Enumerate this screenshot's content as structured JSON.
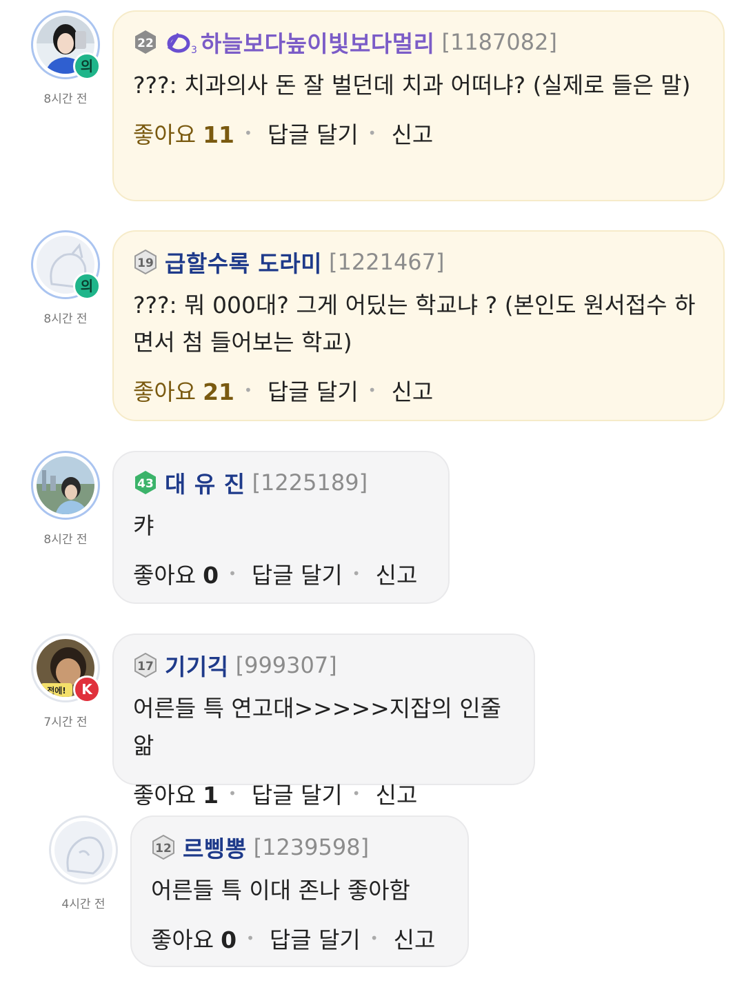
{
  "ui": {
    "like_label": "좋아요",
    "reply_label": "답글 달기",
    "report_label": "신고"
  },
  "comments": [
    {
      "level": "22",
      "nickname": "하늘보다높이빛보다멀리",
      "user_id": "[1187082]",
      "time": "8시간 전",
      "text": "???: 치과의사 돈 잘 벌던데 치과 어떠냐? (실제로 들은 말)",
      "likes": "11",
      "badge": "의"
    },
    {
      "level": "19",
      "nickname": "급할수록 도라미",
      "user_id": "[1221467]",
      "time": "8시간 전",
      "text": "???: 뭐 000대? 그게 어딨는 학교냐 ? (본인도 원서접수 하면서 첨 들어보는 학교)",
      "likes": "21",
      "badge": "의"
    },
    {
      "level": "43",
      "nickname": "대 유 진",
      "user_id": "[1225189]",
      "time": "8시간 전",
      "text": "캬",
      "likes": "0"
    },
    {
      "level": "17",
      "nickname": "기기긱",
      "user_id": "[999307]",
      "time": "7시간 전",
      "text": "어른들 특 연고대>>>>>지잡의 인줄 앎",
      "likes": "1",
      "badge": "K",
      "avatar_caption": "전에!"
    },
    {
      "level": "12",
      "nickname": "르삥뽕",
      "user_id": "[1239598]",
      "time": "4시간 전",
      "text": "어른들 특 이대 존나 좋아함",
      "likes": "0"
    }
  ],
  "colors": {
    "highlight_bubble": "#fef8e8",
    "normal_bubble": "#f5f5f6",
    "nickname": "#1e3a8a",
    "nickname_special": "#7b5cc7",
    "badge_green": "#1fb58a",
    "badge_red": "#e0313c"
  }
}
